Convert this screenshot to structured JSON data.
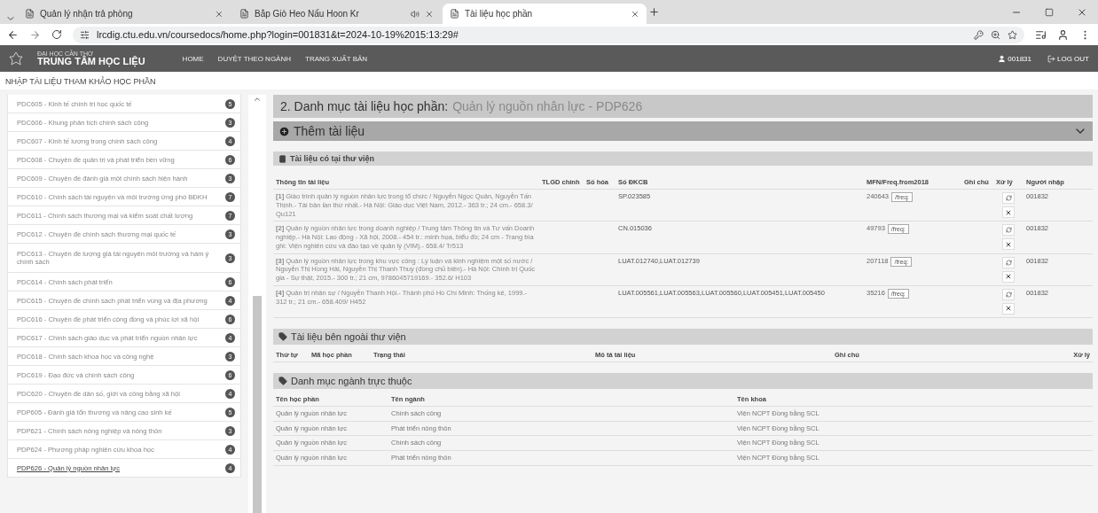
{
  "browser": {
    "tabs": [
      {
        "label": "Quản lý nhận trả phòng",
        "selected": false,
        "audio": false
      },
      {
        "label": "Bắp Giò Heo Nấu Hoon Kr",
        "selected": false,
        "audio": true
      },
      {
        "label": "Tài liệu học phần",
        "selected": true,
        "audio": false
      }
    ],
    "url": "lrcdig.ctu.edu.vn/coursedocs/home.php?login=001831&t=2024-10-19%2015:13:29#"
  },
  "site_nav": {
    "logo_top": "ĐẠI HỌC CẦN THƠ",
    "logo_main": "TRUNG TÂM HỌC LIỆU",
    "menu": [
      "HOME",
      "DUYỆT THEO NGÀNH",
      "TRANG XUẤT BẢN"
    ],
    "user": "001831",
    "logout": "LOG OUT"
  },
  "breadcrumb": "NHẬP TÀI LIỆU THAM KHẢO HỌC PHẦN",
  "sidebar": {
    "items": [
      {
        "label": "PDC605 - Kinh tế chính trị học quốc tế",
        "count": "5",
        "selected": false
      },
      {
        "label": "PDC606 - Khung phân tích chính sách công",
        "count": "3",
        "selected": false
      },
      {
        "label": "PDC607 - Kinh tế lượng trong chính sách công",
        "count": "4",
        "selected": false
      },
      {
        "label": "PDC608 - Chuyên đề quản trị và phát triển bền vững",
        "count": "6",
        "selected": false
      },
      {
        "label": "PDC609 - Chuyên đề đánh giá một chính sách hiện hành",
        "count": "3",
        "selected": false
      },
      {
        "label": "PDC610 - Chính sách tài nguyên và môi trường ứng phó BĐKH",
        "count": "7",
        "selected": false
      },
      {
        "label": "PDC611 - Chính sách thương mại và kiểm soát chất lượng",
        "count": "7",
        "selected": false
      },
      {
        "label": "PDC612 - Chuyên đề chính sách thương mại quốc tế",
        "count": "3",
        "selected": false
      },
      {
        "label": "PDC613 - Chuyên đề lượng giá tài nguyên môi trường và hàm ý chính sách",
        "count": "3",
        "selected": false
      },
      {
        "label": "PDC614 - Chính sách phát triển",
        "count": "6",
        "selected": false
      },
      {
        "label": "PDC615 - Chuyên đề chính sách phát triển vùng và địa phương",
        "count": "4",
        "selected": false
      },
      {
        "label": "PDC616 - Chuyên đề phát triển cộng đồng và phúc lợi xã hội",
        "count": "6",
        "selected": false
      },
      {
        "label": "PDC617 - Chính sách giáo dục và phát triển nguồn nhân lực",
        "count": "4",
        "selected": false
      },
      {
        "label": "PDC618 - Chính sách khoa học và công nghệ",
        "count": "3",
        "selected": false
      },
      {
        "label": "PDC619 - Đạo đức và chính sách công",
        "count": "6",
        "selected": false
      },
      {
        "label": "PDC620 - Chuyên đề dân số, giới và công bằng xã hội",
        "count": "4",
        "selected": false
      },
      {
        "label": "PDP605 - Đánh giá tổn thương và nâng cao sinh kế",
        "count": "5",
        "selected": false
      },
      {
        "label": "PDP621 - Chính sách nông nghiệp và nông thôn",
        "count": "3",
        "selected": false
      },
      {
        "label": "PDP624 - Phương pháp nghiên cứu khoa học",
        "count": "4",
        "selected": false
      },
      {
        "label": "PDP626 - Quản lý nguồn nhân lực",
        "count": "4",
        "selected": true
      }
    ]
  },
  "heading": {
    "title": "2. Danh mục tài liệu học phần:",
    "course": "Quản lý nguồn nhân lực - PDP626"
  },
  "add_panel": {
    "label": "Thêm tài liệu",
    "expanded": false
  },
  "library": {
    "title": "Tài liệu có tại thư viện",
    "columns": [
      "Thông tin tài liệu",
      "TLGD chính",
      "Số hóa",
      "Số ĐKCB",
      "MFN/Freq.from2018",
      "Ghi chú",
      "Xử lý",
      "Người nhập"
    ],
    "rows": [
      {
        "index": "[1]",
        "info": "Giáo trình quản lý nguồn nhân lực trong tổ chức / Nguyễn Ngọc Quân, Nguyễn Tấn Thịnh.- Tái bản lần thứ nhất.- Hà Nội: Giáo dục Việt Nam, 2012.- 363 tr.; 24 cm.- 658.3/ Qu121",
        "dkcb": "SP.023585",
        "mfn": "240643",
        "freq": "/freq:",
        "user": "001832"
      },
      {
        "index": "[2]",
        "info": "Quản lý nguồn nhân lực trong doanh nghiệp / Trung tâm Thông tin và Tư vấn Doanh nghiệp.- Hà Nội: Lao động - Xã hội, 2008.- 454 tr.: minh họa, biểu đồ; 24 cm - Trang bìa ghi: Viện nghiên cứu và đào tạo về quản lý (VIM).- 658.4/ Tr513",
        "dkcb": "CN.015036",
        "mfn": "49793",
        "freq": "/freq:",
        "user": "001832"
      },
      {
        "index": "[3]",
        "info": "Quản lý nguồn nhân lực trong khu vực công : Lý luận và kinh nghiệm một số nước / Nguyễn Thị Hồng Hải, Nguyễn Thị Thanh Thuỷ (đồng chủ biên).- Hà Nội: Chính trị Quốc gia - Sự thật, 2015.- 300 tr.; 21 cm, 9786045719169.- 352.6/ H103",
        "dkcb": "LUAT.012740,LUAT.012739",
        "mfn": "207118",
        "freq": "/freq:",
        "user": "001832"
      },
      {
        "index": "[4]",
        "info": "Quản trị nhân sự / Nguyễn Thanh Hội.- Thành phố Hồ Chí Minh: Thống kê, 1999.- 312 tr.; 21 cm.- 658.409/ H452",
        "dkcb": "LUAT.005561,LUAT.005563,LUAT.005560,LUAT.005451,LUAT.005450",
        "mfn": "35216",
        "freq": "/freq:",
        "user": "001832"
      }
    ]
  },
  "outside": {
    "title": "Tài liệu bên ngoài thư viện",
    "columns": [
      "Thứ tự",
      "Mã học phần",
      "Trạng thái",
      "Mô tả tài liệu",
      "Ghi chú",
      "Xử lý"
    ]
  },
  "majors": {
    "title": "Danh mục ngành trực thuộc",
    "columns": [
      "Tên học phần",
      "Tên ngành",
      "Tên khoa"
    ],
    "rows": [
      [
        "Quản lý nguồn nhân lực",
        "Chính sách công",
        "Viện NCPT Đồng bằng SCL"
      ],
      [
        "Quản lý nguồn nhân lực",
        "Phát triển nông thôn",
        "Viện NCPT Đồng bằng SCL"
      ],
      [
        "Quản lý nguồn nhân lực",
        "Chính sách công",
        "Viện NCPT Đồng bằng SCL"
      ],
      [
        "Quản lý nguồn nhân lực",
        "Phát triển nông thôn",
        "Viện NCPT Đồng bằng SCL"
      ]
    ]
  }
}
